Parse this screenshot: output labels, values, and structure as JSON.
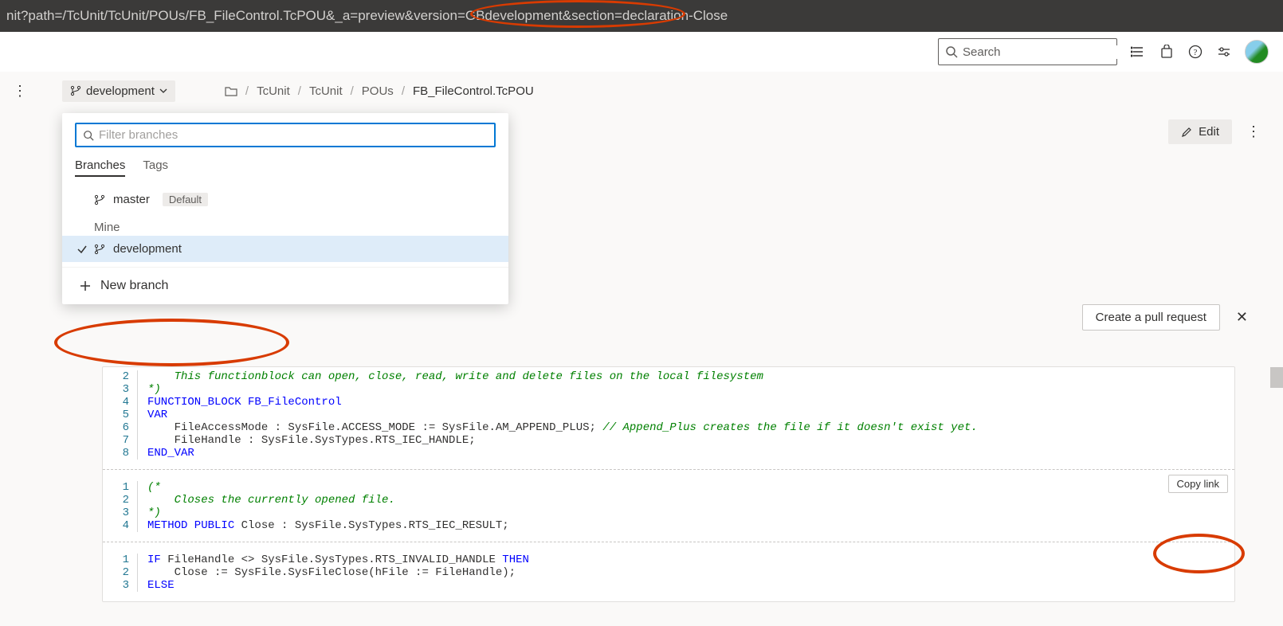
{
  "url_bar": "nit?path=/TcUnit/TcUnit/POUs/FB_FileControl.TcPOU&_a=preview&version=GBdevelopment&section=declaration-Close",
  "search": {
    "placeholder": "Search"
  },
  "branch_button": {
    "label": "development"
  },
  "breadcrumbs": {
    "segs": [
      "TcUnit",
      "TcUnit",
      "POUs",
      "FB_FileControl.TcPOU"
    ]
  },
  "popover": {
    "filter_placeholder": "Filter branches",
    "pivots": {
      "branches": "Branches",
      "tags": "Tags"
    },
    "master": "master",
    "default_badge": "Default",
    "mine_label": "Mine",
    "development": "development",
    "new_branch": "New branch"
  },
  "edit_label": "Edit",
  "pr_label": "Create a pull request",
  "copy_link_label": "Copy link",
  "code": {
    "block1": [
      {
        "n": "2",
        "html": "    This functionblock can open, close, read, write and delete files on the local filesystem",
        "cls": "c-comment"
      },
      {
        "n": "3",
        "html": "*)",
        "cls": "c-comment"
      },
      {
        "n": "4",
        "html": "FUNCTION_BLOCK FB_FileControl",
        "cls": "c-kw"
      },
      {
        "n": "5",
        "html": "VAR",
        "cls": "c-kw"
      },
      {
        "n": "6",
        "html": "    FileAccessMode : SysFile.ACCESS_MODE := SysFile.AM_APPEND_PLUS; // Append_Plus creates the file if it doesn't exist yet.",
        "mix": true
      },
      {
        "n": "7",
        "html": "    FileHandle : SysFile.SysTypes.RTS_IEC_HANDLE;"
      },
      {
        "n": "8",
        "html": "END_VAR",
        "cls": "c-kw"
      }
    ],
    "block2": [
      {
        "n": "1",
        "html": "(*",
        "cls": "c-comment"
      },
      {
        "n": "2",
        "html": "    Closes the currently opened file.",
        "cls": "c-comment"
      },
      {
        "n": "3",
        "html": "*)",
        "cls": "c-comment"
      },
      {
        "n": "4",
        "html": "METHOD PUBLIC Close : SysFile.SysTypes.RTS_IEC_RESULT;",
        "mix2": true
      }
    ],
    "block3": [
      {
        "n": "1",
        "html": "IF FileHandle <> SysFile.SysTypes.RTS_INVALID_HANDLE THEN",
        "mix3": true
      },
      {
        "n": "2",
        "html": "    Close := SysFile.SysFileClose(hFile := FileHandle);"
      },
      {
        "n": "3",
        "html": "ELSE",
        "cls": "c-kw"
      }
    ]
  }
}
